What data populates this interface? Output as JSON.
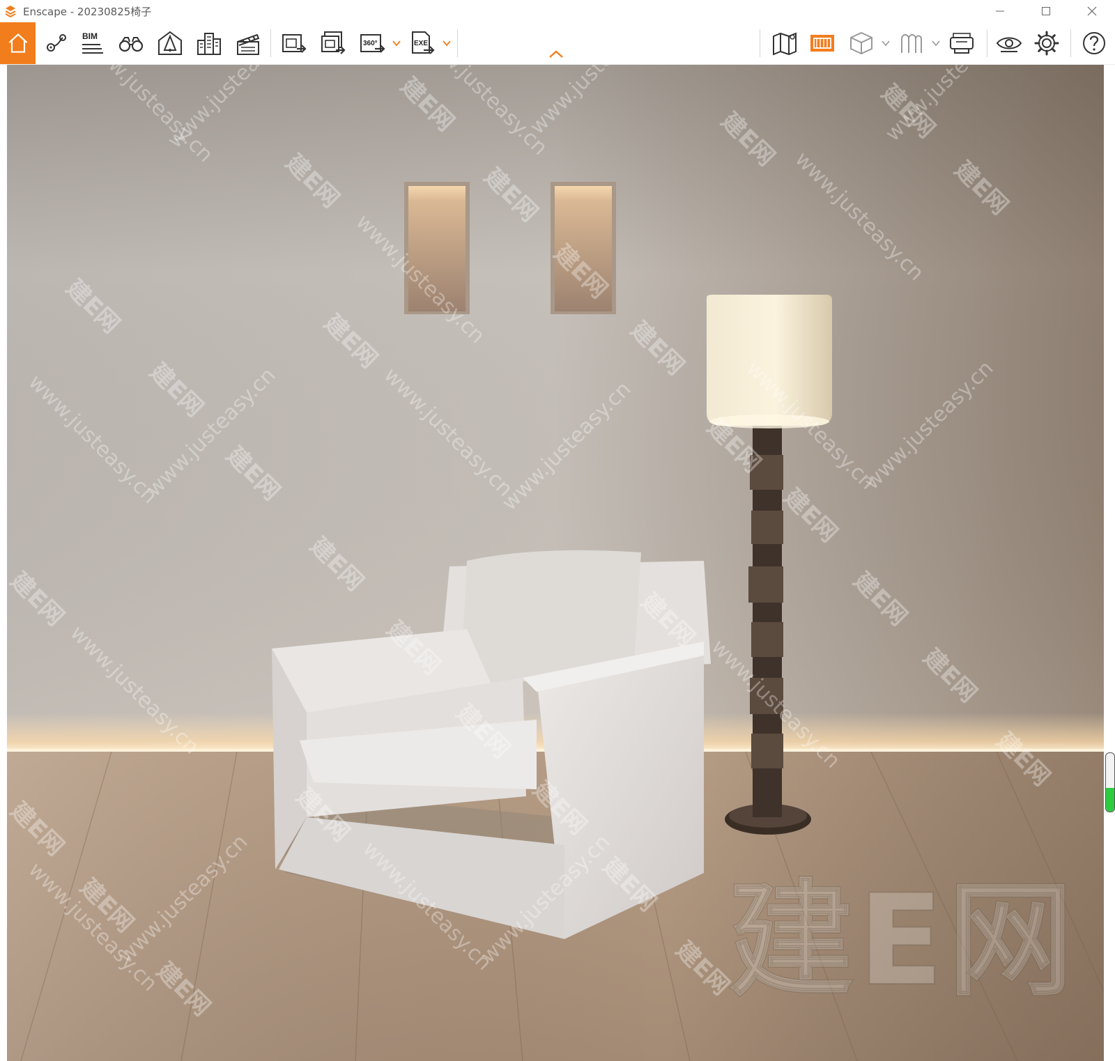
{
  "window": {
    "title": "Enscape - 20230825椅子",
    "controls": [
      "minimize-icon",
      "maximize-icon",
      "close-icon"
    ]
  },
  "toolbar": {
    "left_icons": [
      {
        "name": "home-icon",
        "active": true
      },
      {
        "name": "map-pin-icon"
      },
      {
        "name": "bim-icon",
        "label": "BIM"
      },
      {
        "name": "binoculars-icon"
      },
      {
        "name": "sun-position-icon"
      },
      {
        "name": "buildings-icon"
      },
      {
        "name": "clapperboard-icon"
      },
      {
        "name": "render-screenshot-icon"
      },
      {
        "name": "batch-render-icon"
      },
      {
        "name": "panorama-360-icon",
        "label": "360°"
      },
      {
        "name": "export-exe-icon",
        "label": "EXE"
      }
    ],
    "right_icons": [
      {
        "name": "map-view-icon"
      },
      {
        "name": "asset-library-icon",
        "active": true
      },
      {
        "name": "cube-view-icon"
      },
      {
        "name": "material-editor-icon"
      },
      {
        "name": "vr-headset-icon"
      },
      {
        "name": "visibility-eye-icon"
      },
      {
        "name": "settings-gear-icon"
      },
      {
        "name": "help-icon"
      }
    ],
    "accent_color": "#f27d1d"
  },
  "viewport": {
    "scene": "armchair-and-floor-lamp-render",
    "nav_indicator_level": 0.4,
    "watermarks": {
      "brand": "建E网",
      "url": "www.justeasy.cn"
    }
  }
}
